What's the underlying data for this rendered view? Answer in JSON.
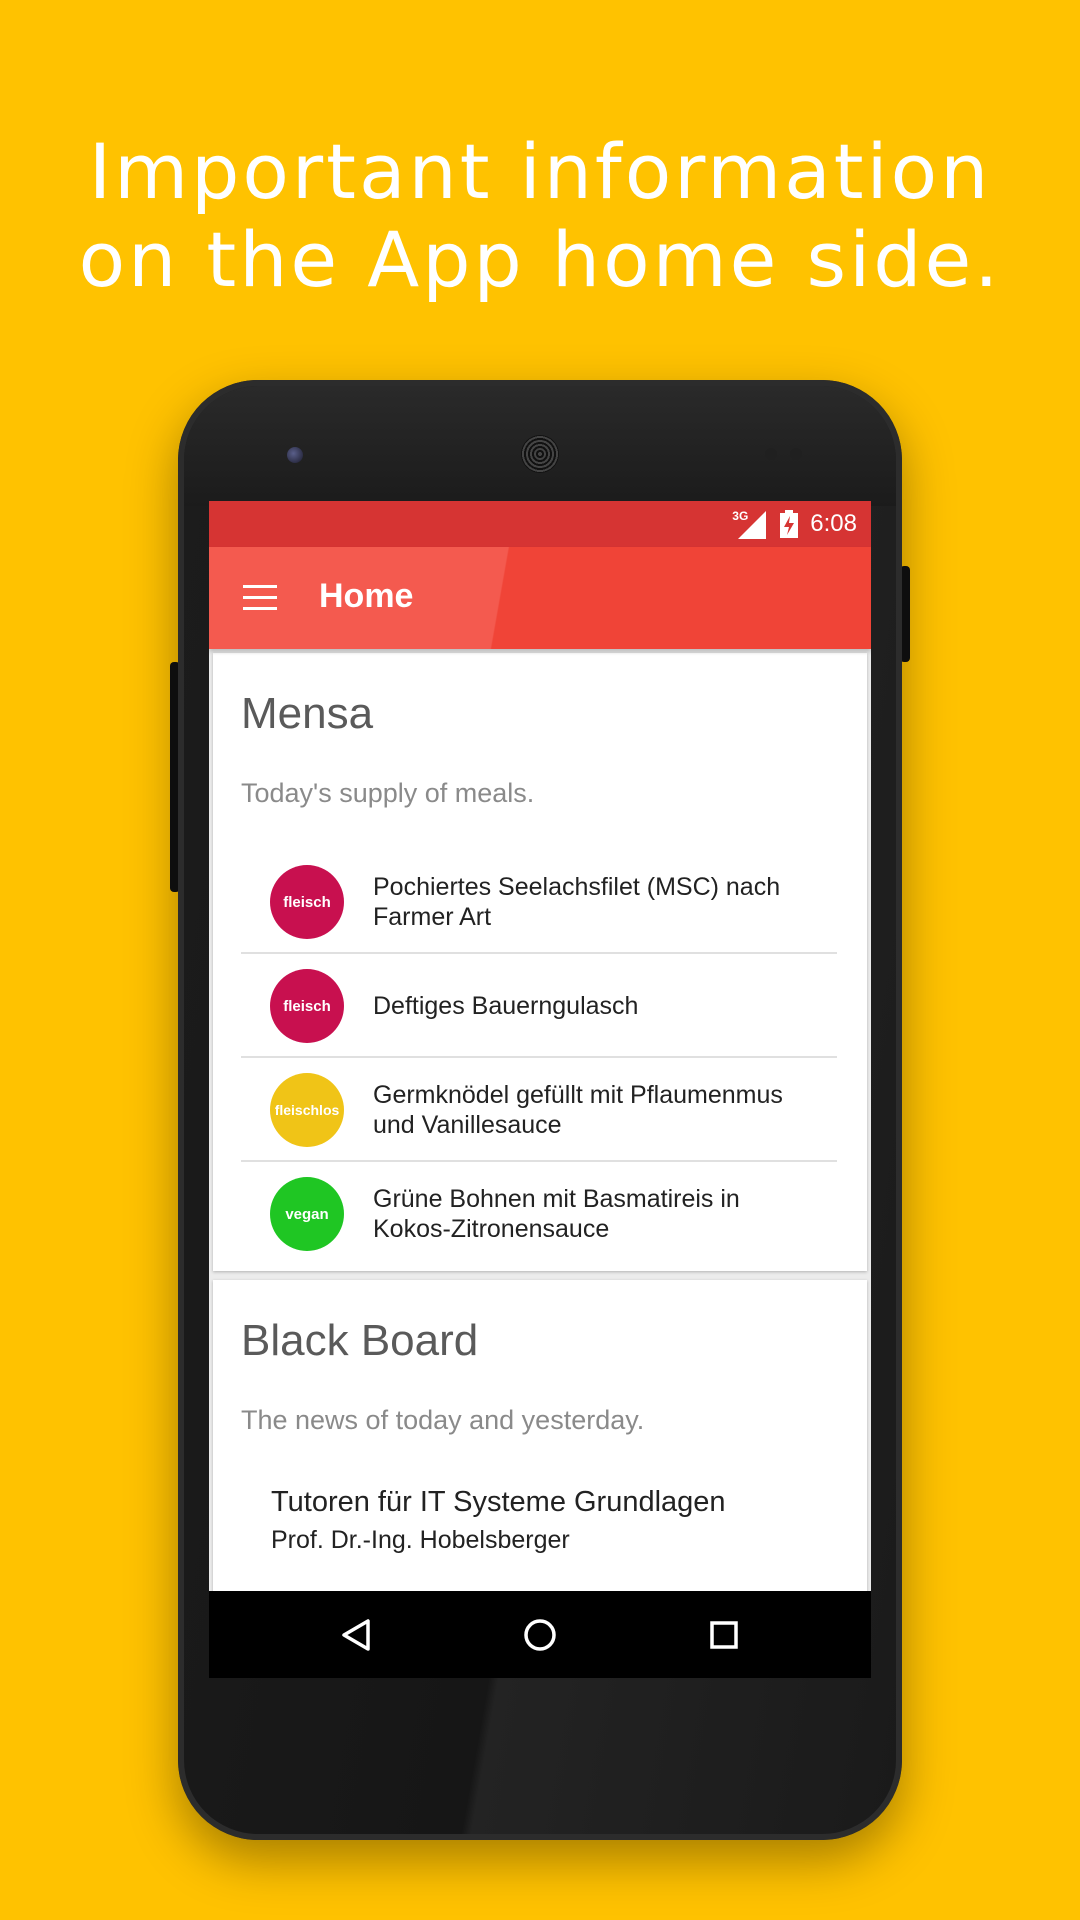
{
  "headline": {
    "line1": "Important information",
    "line2": "on the App home side."
  },
  "status_bar": {
    "network": "3G",
    "time": "6:08"
  },
  "app_bar": {
    "title": "Home",
    "menu_icon": "hamburger-menu-icon"
  },
  "mensa_card": {
    "title": "Mensa",
    "subtitle": "Today's supply of meals.",
    "meals": [
      {
        "badge": "fleisch",
        "badge_color": "#c8104f",
        "name": "Pochiertes Seelachsfilet (MSC) nach Farmer Art"
      },
      {
        "badge": "fleisch",
        "badge_color": "#c8104f",
        "name": "Deftiges Bauerngulasch"
      },
      {
        "badge": "fleischlos",
        "badge_color": "#f0c417",
        "name": "Germknödel gefüllt mit Pflaumenmus und Vanillesauce"
      },
      {
        "badge": "vegan",
        "badge_color": "#1fc623",
        "name": "Grüne Bohnen mit Basmatireis in Kokos-Zitronensauce"
      }
    ]
  },
  "blackboard_card": {
    "title": "Black Board",
    "subtitle": "The news of today and yesterday.",
    "news": [
      {
        "title": "Tutoren für IT Systeme Grundlagen",
        "author": "Prof. Dr.-Ing. Hobelsberger"
      }
    ]
  },
  "nav_bar": {
    "back": "back-icon",
    "home": "home-icon",
    "recents": "recents-icon"
  },
  "colors": {
    "background": "#FFC200",
    "app_bar": "#f04437",
    "status_bar": "#d63433"
  }
}
